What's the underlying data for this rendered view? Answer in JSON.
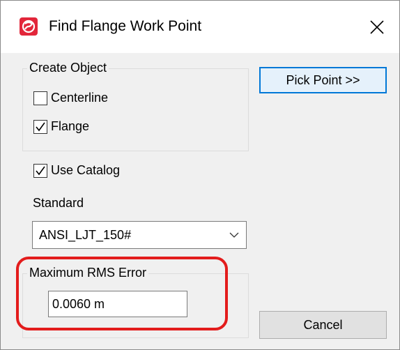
{
  "window": {
    "title": "Find Flange Work Point",
    "accent_color": "#e2263a"
  },
  "create_object": {
    "legend": "Create Object",
    "centerline": {
      "label": "Centerline",
      "checked": false
    },
    "flange": {
      "label": "Flange",
      "checked": true
    }
  },
  "use_catalog": {
    "label": "Use Catalog",
    "checked": true
  },
  "standard": {
    "label": "Standard",
    "selected": "ANSI_LJT_150#"
  },
  "rms": {
    "legend": "Maximum RMS Error",
    "value": "0.0060 m"
  },
  "buttons": {
    "pick_point": "Pick Point >>",
    "cancel": "Cancel"
  },
  "annotation": {
    "ring_color": "#e31c1c"
  }
}
